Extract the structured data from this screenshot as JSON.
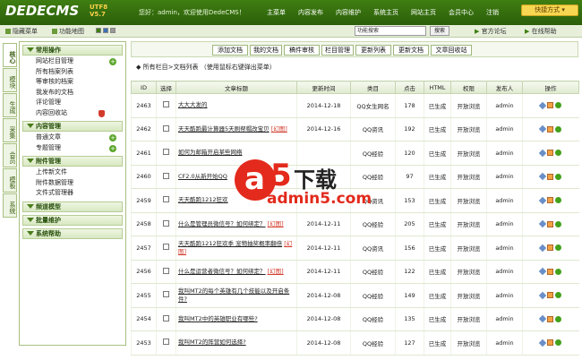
{
  "app": {
    "logo": "DEDECMS",
    "version_tag": "V5.7",
    "ver_label": "UTF8",
    "welcome": "您好：admin，欢迎使用DedeCMS！"
  },
  "topnav": [
    "主菜单",
    "内容发布",
    "内容维护",
    "系统主页",
    "网站主页",
    "会员中心",
    "注销"
  ],
  "quick_button": "快捷方式",
  "subbar": {
    "hide_menu": "隐藏菜单",
    "func_map": "功能地图",
    "search_value": "功能搜索",
    "search_button": "搜索",
    "forum": "官方论坛",
    "help": "在线帮助"
  },
  "vtabs": [
    "核心",
    "模块",
    "生成",
    "采集",
    "会员",
    "模板",
    "系统"
  ],
  "sidebar": [
    {
      "section": "常用操作",
      "items": [
        "网站栏目管理",
        "所有档案列表",
        "等审核的档案",
        "我发布的文档",
        "评论管理",
        "内容回收站"
      ]
    },
    {
      "section": "内容管理",
      "items": [
        "普通文章",
        "专题管理"
      ]
    },
    {
      "section": "附件管理",
      "items": [
        "上传新文件",
        "附件数据管理",
        "文件式管理器"
      ]
    },
    {
      "section": "频道模型",
      "items": []
    },
    {
      "section": "批量维护",
      "items": []
    },
    {
      "section": "系统帮助",
      "items": []
    }
  ],
  "toolbar": [
    "添加文档",
    "我的文档",
    "稿件审核",
    "栏目管理",
    "更新列表",
    "更新文档",
    "文章回收站"
  ],
  "list_heading": "所有栏目>文档列表 （使用鼠标右键弹出菜单）",
  "columns": [
    "ID",
    "选择",
    "文章标题",
    "更新时间",
    "类目",
    "点击",
    "HTML",
    "权限",
    "发布人",
    "操作"
  ],
  "rows": [
    {
      "id": "2463",
      "title": "大大大发的",
      "flag": "",
      "date": "2014-12-18",
      "cat": "QQ女生网名",
      "clicks": "178",
      "html": "已生成",
      "perm": "开放浏览",
      "author": "admin"
    },
    {
      "id": "2462",
      "title": "天天酷跑最计算器5天刷帮帽改宝贝",
      "flag": "[幻图]",
      "date": "2014-12-16",
      "cat": "QQ资讯",
      "clicks": "192",
      "html": "已生成",
      "perm": "开放浏览",
      "author": "admin"
    },
    {
      "id": "2461",
      "title": "如何为邮箱开启某些网络",
      "flag": "",
      "date": "",
      "cat": "QQ经验",
      "clicks": "120",
      "html": "已生成",
      "perm": "开放浏览",
      "author": "admin"
    },
    {
      "id": "2460",
      "title": "CF2.0从新开始QQ",
      "flag": "",
      "date": "",
      "cat": "QQ经验",
      "clicks": "97",
      "html": "已生成",
      "perm": "开放浏览",
      "author": "admin"
    },
    {
      "id": "2459",
      "title": "天天酷跑1212狂欢",
      "flag": "",
      "date": "",
      "cat": "QQ资讯",
      "clicks": "153",
      "html": "已生成",
      "perm": "开放浏览",
      "author": "admin"
    },
    {
      "id": "2458",
      "title": "什么是管理员微信号？如何绑定？",
      "flag": "[幻图]",
      "date": "2014-12-11",
      "cat": "QQ经验",
      "clicks": "205",
      "html": "已生成",
      "perm": "开放浏览",
      "author": "admin"
    },
    {
      "id": "2457",
      "title": "天天酷跑1212狂欢季 宠物抽奖概率翻倍",
      "flag": "[幻图]",
      "date": "2014-12-11",
      "cat": "QQ资讯",
      "clicks": "156",
      "html": "已生成",
      "perm": "开放浏览",
      "author": "admin"
    },
    {
      "id": "2456",
      "title": "什么是运营者微信号？如何绑定？",
      "flag": "[幻图]",
      "date": "2014-12-11",
      "cat": "QQ经验",
      "clicks": "122",
      "html": "已生成",
      "perm": "开放浏览",
      "author": "admin"
    },
    {
      "id": "2455",
      "title": "我叫MT2的每个英雄有几个技能以及开启条件?",
      "flag": "",
      "date": "2014-12-08",
      "cat": "QQ经验",
      "clicks": "149",
      "html": "已生成",
      "perm": "开放浏览",
      "author": "admin"
    },
    {
      "id": "2454",
      "title": "我叫MT2中的英雄职业有哪些?",
      "flag": "",
      "date": "2014-12-08",
      "cat": "QQ经验",
      "clicks": "135",
      "html": "已生成",
      "perm": "开放浏览",
      "author": "admin"
    },
    {
      "id": "2453",
      "title": "我叫MT2的阵营如何选择?",
      "flag": "",
      "date": "2014-12-08",
      "cat": "QQ经验",
      "clicks": "127",
      "html": "已生成",
      "perm": "开放浏览",
      "author": "admin"
    }
  ],
  "watermark": {
    "brand_a": "a",
    "brand_5": "5",
    "brand_dl": "下载",
    "url": "admin5.com"
  }
}
